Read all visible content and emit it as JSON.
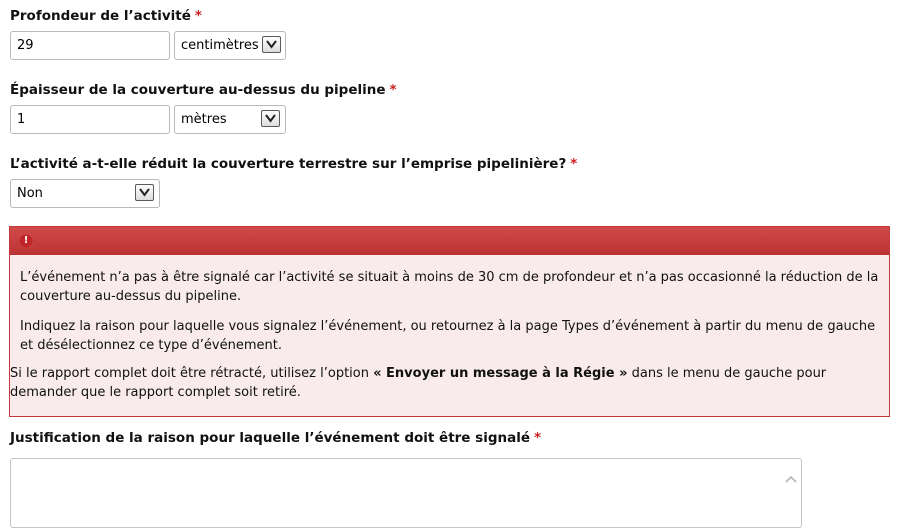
{
  "fields": {
    "depth": {
      "label": "Profondeur de l’activité",
      "required_mark": "*",
      "value": "29",
      "unit_selected": "centimètres"
    },
    "cover_thickness": {
      "label": "Épaisseur de la couverture au-dessus du pipeline",
      "required_mark": "*",
      "value": "1",
      "unit_selected": "mètres"
    },
    "cover_reduced": {
      "label": "L’activité a-t-elle réduit la couverture terrestre sur l’emprise pipelinière?",
      "required_mark": "*",
      "selected": "Non"
    },
    "justification": {
      "label": "Justification de la raison pour laquelle l’événement doit être signalé",
      "required_mark": "*",
      "value": ""
    }
  },
  "alert": {
    "icon": "exclamation-icon",
    "icon_glyph": "!",
    "paragraph1": "L’événement n’a pas à être signalé car l’activité se situait à moins de 30 cm de profondeur et n’a pas occasionné la réduction de la couverture au-dessus du pipeline.",
    "paragraph2": "Indiquez la raison pour laquelle vous signalez l’événement, ou retournez à la page Types d’événement à partir du menu de gauche et désélectionnez ce type d’événement.",
    "paragraph3_before": "Si le rapport complet doit être rétracté, utilisez l’option ",
    "paragraph3_bold": "« Envoyer un message à la Régie »",
    "paragraph3_after": " dans le menu de gauche pour demander que le rapport complet soit retiré."
  },
  "colors": {
    "required": "#cc1f1f",
    "alert_header": "#c0393b",
    "alert_background": "#f9ebeb"
  }
}
